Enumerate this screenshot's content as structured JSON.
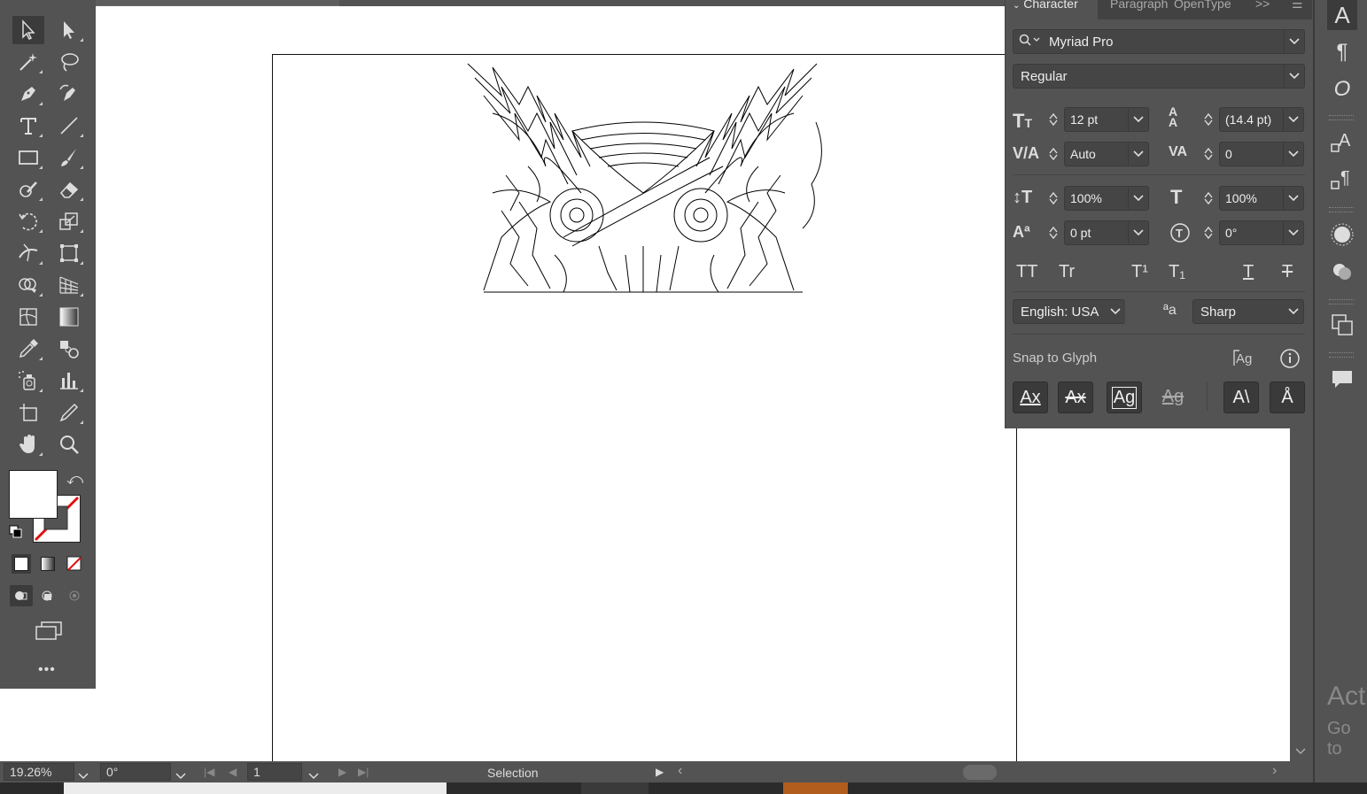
{
  "canvas": {
    "bg": "#ffffff"
  },
  "toolbar": {
    "tools": [
      "selection-tool",
      "direct-selection-tool",
      "magic-wand-tool",
      "lasso-tool",
      "pen-tool",
      "curvature-tool",
      "type-tool",
      "line-tool",
      "rectangle-tool",
      "paintbrush-tool",
      "shaper-tool",
      "eraser-tool",
      "rotate-tool",
      "scale-tool",
      "width-tool",
      "free-transform-tool",
      "shape-builder-tool",
      "perspective-grid-tool",
      "mesh-tool",
      "gradient-tool",
      "eyedropper-tool",
      "blend-tool",
      "symbol-sprayer-tool",
      "column-graph-tool",
      "artboard-tool",
      "slice-tool",
      "hand-tool",
      "zoom-tool"
    ],
    "more_label": "•••"
  },
  "character_panel": {
    "tabs": [
      "Character",
      "Paragraph",
      "OpenType"
    ],
    "tab_overflow": ">>",
    "font_family": "Myriad Pro",
    "font_style": "Regular",
    "font_size": "12 pt",
    "leading": "(14.4 pt)",
    "kerning": "Auto",
    "tracking": "0",
    "vertical_scale": "100%",
    "horizontal_scale": "100%",
    "baseline_shift": "0 pt",
    "rotation": "0°",
    "style_buttons": [
      "TT",
      "Tr",
      "T¹",
      "T₁",
      "T",
      "T"
    ],
    "language": "English: USA",
    "antialias_icon": "ªa",
    "antialias": "Sharp",
    "snap_label": "Snap to Glyph"
  },
  "status": {
    "zoom": "19.26%",
    "rotation": "0°",
    "artboard": "1",
    "tool": "Selection"
  },
  "watermark": {
    "line1": "Act",
    "line2": "Go to"
  }
}
